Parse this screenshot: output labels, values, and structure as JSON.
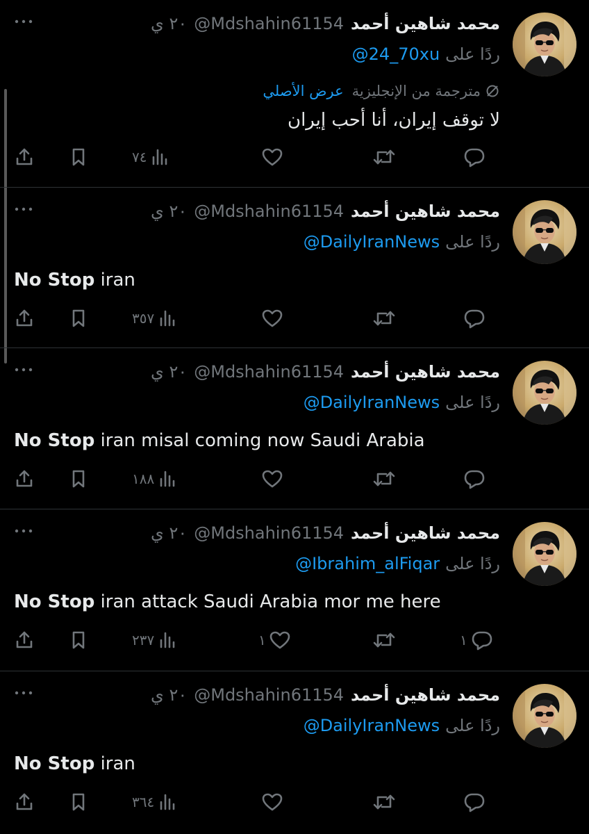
{
  "user": {
    "name": "محمد شاهين أحمد",
    "handle": "@Mdshahin61154",
    "time": "٢٠ ي"
  },
  "reply_prefix": "ردًا على",
  "translation": {
    "label": "مترجمة من الإنجليزية",
    "show_original": "عرض الأصلي"
  },
  "colors": {
    "background": "#000000",
    "text": "#e7e9ea",
    "muted": "#71767b",
    "accent": "#1d9bf0",
    "divider": "#2f3336"
  },
  "icons": {
    "reply": "reply-icon",
    "retweet": "retweet-icon",
    "like": "heart-icon",
    "views": "views-icon",
    "bookmark": "bookmark-icon",
    "share": "share-icon",
    "more": "more-icon",
    "translate": "translate-icon"
  },
  "tweets": [
    {
      "reply_to": "@24_70xu",
      "translated": true,
      "text": "لا توقف إيران، أنا أحب إيران",
      "bold": "",
      "rest": "",
      "views": "٧٤",
      "likes": "",
      "replies": ""
    },
    {
      "reply_to": "@DailyIranNews",
      "translated": false,
      "bold": "No Stop",
      "rest": " iran",
      "views": "٣٥٧",
      "likes": "",
      "replies": ""
    },
    {
      "reply_to": "@DailyIranNews",
      "translated": false,
      "bold": "No Stop",
      "rest": " iran misal coming now Saudi Arabia",
      "views": "١٨٨",
      "likes": "",
      "replies": ""
    },
    {
      "reply_to": "@Ibrahim_alFiqar",
      "translated": false,
      "bold": "No Stop",
      "rest": " iran attack Saudi Arabia mor me here",
      "views": "٢٣٧",
      "likes": "١",
      "replies": "١"
    },
    {
      "reply_to": "@DailyIranNews",
      "translated": false,
      "bold": "No Stop",
      "rest": " iran",
      "views": "٣٦٤",
      "likes": "",
      "replies": ""
    }
  ]
}
